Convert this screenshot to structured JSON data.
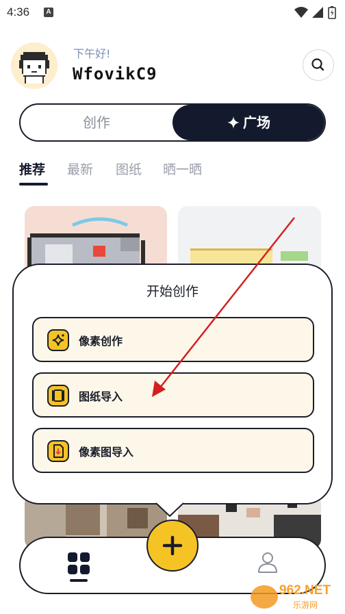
{
  "status_bar": {
    "time": "4:36",
    "notification_letter": "A"
  },
  "header": {
    "greeting": "下午好!",
    "username": "WfovikC9"
  },
  "segmented": {
    "create_label": "创作",
    "plaza_label": "广场"
  },
  "tabs": [
    {
      "label": "推荐",
      "active": true
    },
    {
      "label": "最新",
      "active": false
    },
    {
      "label": "图纸",
      "active": false
    },
    {
      "label": "晒一晒",
      "active": false
    }
  ],
  "popup": {
    "title": "开始创作",
    "options": [
      {
        "label": "像素创作",
        "icon": "sparkle-icon"
      },
      {
        "label": "图纸导入",
        "icon": "scroll-icon"
      },
      {
        "label": "像素图导入",
        "icon": "image-import-icon"
      }
    ]
  },
  "bottom_nav": {
    "home_icon": "grid-icon",
    "profile_icon": "user-icon",
    "fab_icon": "plus-icon"
  },
  "watermark": {
    "brand": "962.NET",
    "sub": "乐游网"
  },
  "colors": {
    "dark": "#141a2e",
    "accent_yellow": "#f6c325",
    "option_bg": "#fdf7ea",
    "greeting": "#7f8fb8",
    "arrow": "#d42020"
  }
}
